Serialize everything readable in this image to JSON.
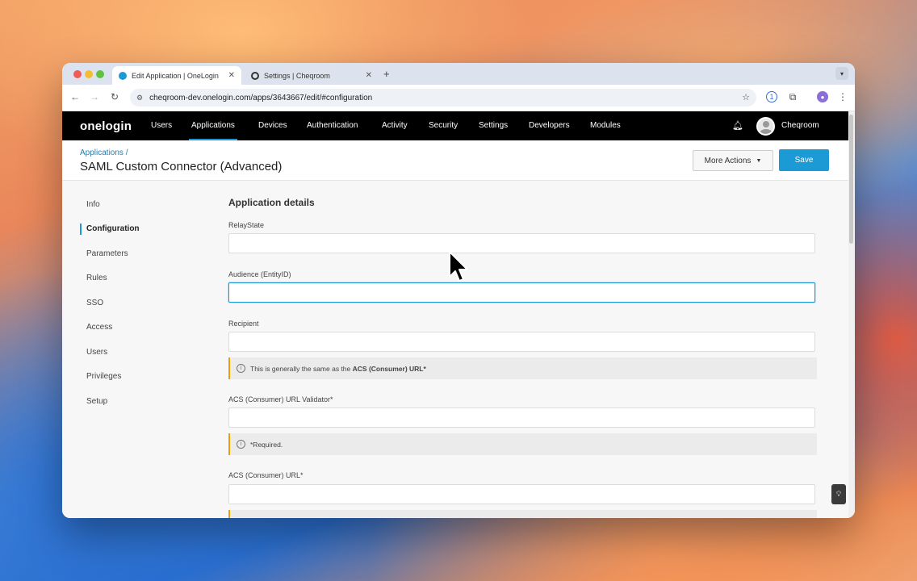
{
  "browser": {
    "tabs": [
      {
        "title": "Edit Application | OneLogin",
        "active": true
      },
      {
        "title": "Settings | Cheqroom",
        "active": false
      }
    ],
    "new_tab": "+",
    "url": "cheqroom-dev.onelogin.com/apps/3643667/edit/#configuration"
  },
  "app": {
    "logo": "onelogin",
    "nav": [
      "Users",
      "Applications",
      "Devices",
      "Authentication",
      "Activity",
      "Security",
      "Settings",
      "Developers",
      "Modules"
    ],
    "active_nav": "Applications",
    "account_name": "Cheqroom",
    "breadcrumb": "Applications /",
    "page_title": "SAML Custom Connector (Advanced)",
    "more_actions_label": "More Actions",
    "save_label": "Save"
  },
  "sidebar": {
    "items": [
      "Info",
      "Configuration",
      "Parameters",
      "Rules",
      "SSO",
      "Access",
      "Users",
      "Privileges",
      "Setup"
    ],
    "active": "Configuration"
  },
  "form": {
    "section_title": "Application details",
    "fields": [
      {
        "label": "RelayState",
        "value": ""
      },
      {
        "label": "Audience (EntityID)",
        "value": ""
      },
      {
        "label": "Recipient",
        "value": ""
      },
      {
        "label": "ACS (Consumer) URL Validator*",
        "value": ""
      },
      {
        "label": "ACS (Consumer) URL*",
        "value": ""
      }
    ],
    "hint_recipient_prefix": "This is generally the same as the",
    "hint_recipient_bold": "ACS (Consumer) URL*",
    "hint_validator": "*Required."
  },
  "colors": {
    "accent": "#1c9ad6",
    "topnav": "#000000",
    "hint_border": "#f0a000"
  }
}
